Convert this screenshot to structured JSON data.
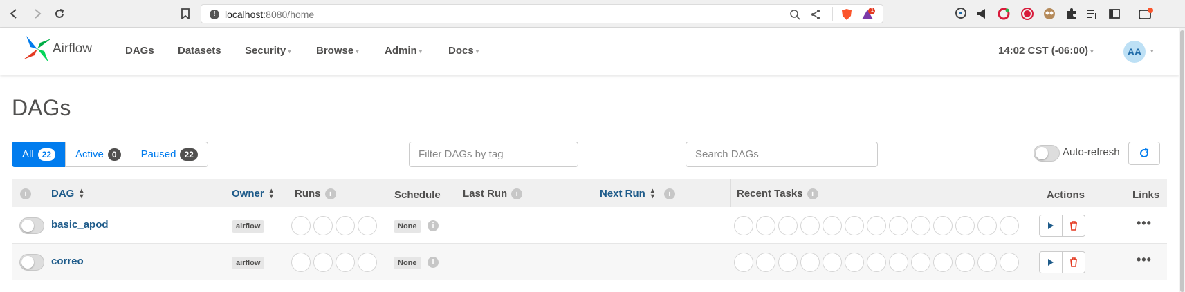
{
  "browser": {
    "url_host": "localhost",
    "url_path": ":8080/home",
    "notification_count": "1"
  },
  "navbar": {
    "brand": "Airflow",
    "menu": [
      {
        "label": "DAGs",
        "dropdown": false
      },
      {
        "label": "Datasets",
        "dropdown": false
      },
      {
        "label": "Security",
        "dropdown": true
      },
      {
        "label": "Browse",
        "dropdown": true
      },
      {
        "label": "Admin",
        "dropdown": true
      },
      {
        "label": "Docs",
        "dropdown": true
      }
    ],
    "clock": "14:02 CST (-06:00)",
    "avatar_initials": "AA"
  },
  "page": {
    "title": "DAGs",
    "filters": {
      "all_label": "All",
      "all_count": "22",
      "active_label": "Active",
      "active_count": "0",
      "paused_label": "Paused",
      "paused_count": "22"
    },
    "tag_filter_placeholder": "Filter DAGs by tag",
    "search_placeholder": "Search DAGs",
    "auto_refresh_label": "Auto-refresh"
  },
  "table": {
    "headers": {
      "dag": "DAG",
      "owner": "Owner",
      "runs": "Runs",
      "schedule": "Schedule",
      "last_run": "Last Run",
      "next_run": "Next Run",
      "recent_tasks": "Recent Tasks",
      "actions": "Actions",
      "links": "Links"
    },
    "rows": [
      {
        "name": "basic_apod",
        "owner": "airflow",
        "schedule": "None",
        "paused": true
      },
      {
        "name": "correo",
        "owner": "airflow",
        "schedule": "None",
        "paused": true
      }
    ]
  },
  "colors": {
    "primary": "#017cee",
    "link": "#1e5b8a",
    "delete": "#e43921",
    "text": "#51504f"
  }
}
